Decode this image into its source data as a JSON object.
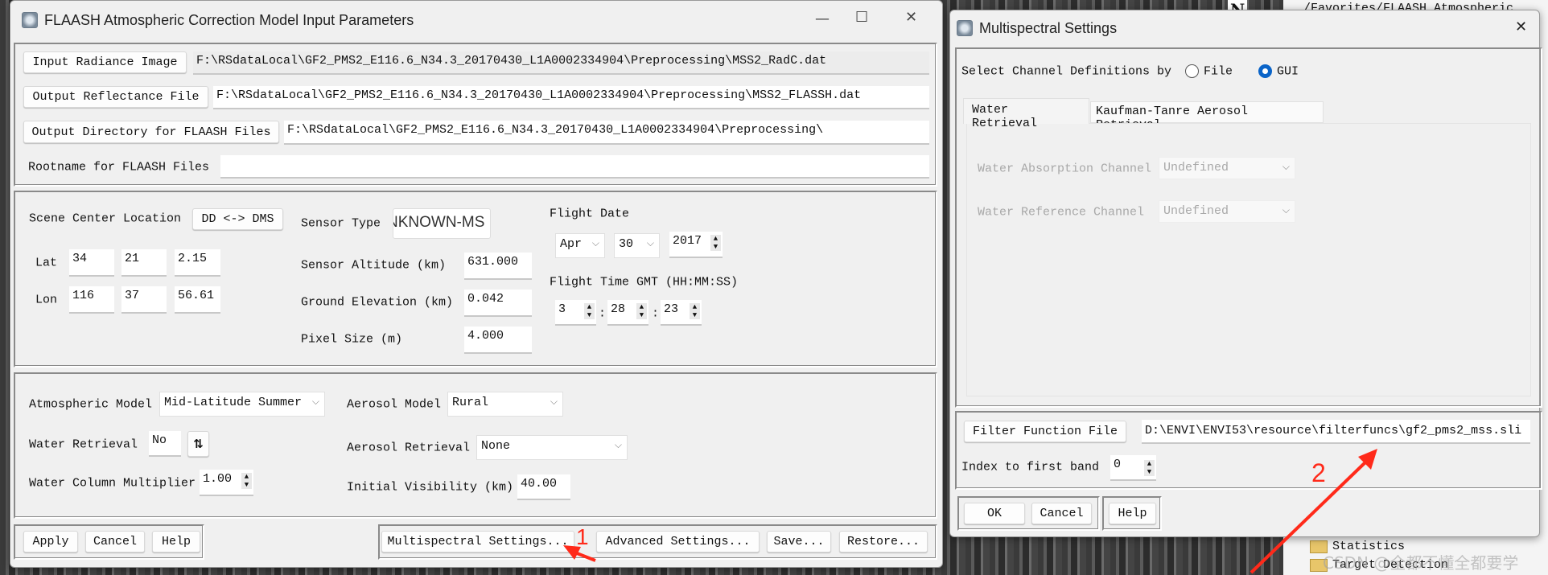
{
  "background": {
    "path_text": "/Favorites/FLAASH Atmospheric Corr",
    "north_label": "N",
    "tree_items": [
      "Statistics",
      "Target Detection"
    ],
    "watermark": "CSDN @全都不懂全都要学"
  },
  "main": {
    "title": "FLAASH Atmospheric Correction Model Input Parameters",
    "window_controls": {
      "minimize": "—",
      "maximize": "☐",
      "close": "✕"
    },
    "files": {
      "input_button": "Input Radiance Image",
      "input_value": "F:\\RSdataLocal\\GF2_PMS2_E116.6_N34.3_20170430_L1A0002334904\\Preprocessing\\MSS2_RadC.dat",
      "output_button": "Output Reflectance File",
      "output_value": "F:\\RSdataLocal\\GF2_PMS2_E116.6_N34.3_20170430_L1A0002334904\\Preprocessing\\MSS2_FLASSH.dat",
      "dir_button": "Output Directory for FLAASH Files",
      "dir_value": "F:\\RSdataLocal\\GF2_PMS2_E116.6_N34.3_20170430_L1A0002334904\\Preprocessing\\",
      "rootname_label": "Rootname for FLAASH Files",
      "rootname_value": ""
    },
    "scene": {
      "label": "Scene Center Location",
      "toggle_button": "DD <-> DMS",
      "lat_label": "Lat",
      "lat": [
        "34",
        "21",
        "2.15"
      ],
      "lon_label": "Lon",
      "lon": [
        "116",
        "37",
        "56.61"
      ],
      "sensor_type_label": "Sensor Type",
      "sensor_type": "NKNOWN-MS",
      "sensor_altitude_label": "Sensor Altitude (km)",
      "sensor_altitude": "631.000",
      "ground_elevation_label": "Ground Elevation (km)",
      "ground_elevation": "0.042",
      "pixel_size_label": "Pixel Size (m)",
      "pixel_size": "4.000",
      "flight_date_label": "Flight Date",
      "month": "Apr",
      "day": "30",
      "year": "2017",
      "flight_time_label": "Flight Time GMT (HH:MM:SS)",
      "hh": "3",
      "mm": "28",
      "ss": "23",
      "sep": ":"
    },
    "models": {
      "atmos_label": "Atmospheric Model",
      "atmos": "Mid-Latitude Summer",
      "aerosol_label": "Aerosol Model",
      "aerosol": "Rural",
      "water_label": "Water Retrieval",
      "water": "No",
      "aerosol_retrieval_label": "Aerosol Retrieval",
      "aerosol_retrieval": "None",
      "wcm_label": "Water Column Multiplier",
      "wcm": "1.00",
      "visibility_label": "Initial Visibility (km)",
      "visibility": "40.00"
    },
    "buttons": {
      "apply": "Apply",
      "cancel": "Cancel",
      "help": "Help",
      "multispectral": "Multispectral Settings...",
      "advanced": "Advanced Settings...",
      "save": "Save...",
      "restore": "Restore..."
    }
  },
  "multispectral": {
    "title": "Multispectral Settings",
    "close": "✕",
    "select_label": "Select Channel Definitions by",
    "option_file": "File",
    "option_gui": "GUI",
    "selected": "GUI",
    "tabs": [
      "Water Retrieval",
      "Kaufman-Tanre Aerosol Retrieval"
    ],
    "active_tab": "Water Retrieval",
    "absorption_label": "Water Absorption Channel",
    "absorption": "Undefined",
    "reference_label": "Water Reference Channel",
    "reference": "Undefined",
    "filter_button": "Filter Function File",
    "filter_value": "D:\\ENVI\\ENVI53\\resource\\filterfuncs\\gf2_pms2_mss.sli",
    "index_label": "Index to first band",
    "index": "0",
    "ok": "OK",
    "cancel": "Cancel",
    "help": "Help"
  },
  "annotations": {
    "step1": "1",
    "step2": "2",
    "color": "#ff2a1a"
  }
}
